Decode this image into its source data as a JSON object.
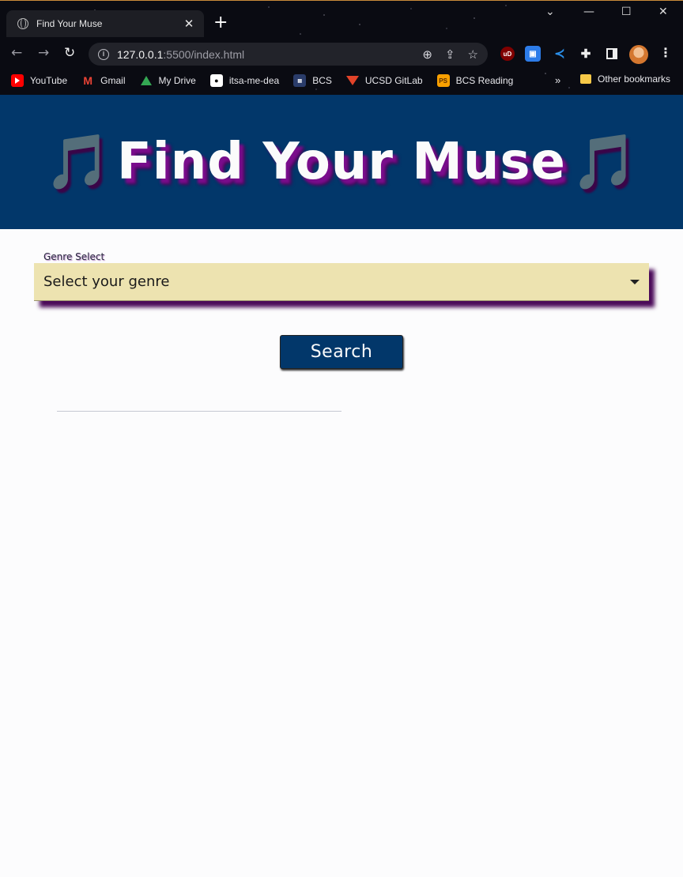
{
  "browser": {
    "tab_title": "Find Your Muse",
    "tab_close": "✕",
    "new_tab": "+",
    "url_host": "127.0.0.1",
    "url_path": ":5500/index.html",
    "window_controls": {
      "chevron": "⌄",
      "minimize": "—",
      "maximize": "☐",
      "close": "✕"
    },
    "nav": {
      "back": "←",
      "forward": "→",
      "reload": "↻"
    },
    "extensions": {
      "ublock": "uD"
    },
    "bookmarks": [
      {
        "label": "YouTube",
        "icon": "youtube-icon"
      },
      {
        "label": "Gmail",
        "icon": "gmail-icon"
      },
      {
        "label": "My Drive",
        "icon": "drive-icon"
      },
      {
        "label": "itsa-me-dea",
        "icon": "github-icon"
      },
      {
        "label": "BCS",
        "icon": "bcs-icon"
      },
      {
        "label": "UCSD GitLab",
        "icon": "gitlab-icon"
      },
      {
        "label": "BCS Reading",
        "icon": "ps-icon"
      }
    ],
    "bookmarks_more": "»",
    "other_bookmarks": "Other bookmarks"
  },
  "page": {
    "title": "Find Your Muse",
    "note_left": "🎵",
    "note_right": "🎵",
    "genre_label": "Genre Select",
    "genre_value": "Select your genre",
    "search_label": "Search"
  },
  "colors": {
    "hero_bg": "#02376a",
    "select_bg": "#ede3b0",
    "shadow_purple": "#4b0a59",
    "note_purple": "#8b1aa0"
  }
}
